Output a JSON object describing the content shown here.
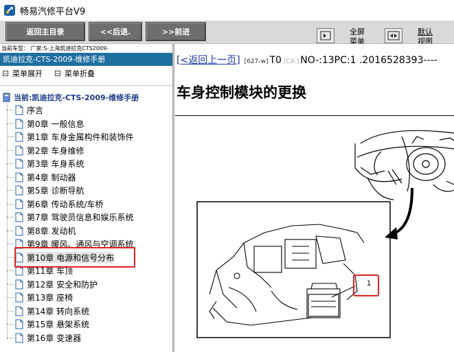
{
  "app": {
    "title": "畅易汽修平台V9"
  },
  "toolbar": {
    "back_main": "返回主目录",
    "back": "<<后退.",
    "forward": ">>前进",
    "fullscreen_line1": "全屏",
    "fullscreen_line2": "菜单",
    "default_line1": "默认",
    "default_line2": "视图"
  },
  "model_bar": "当前车型：  厂家:S-上海凯迪拉克CTS2009-",
  "sidebar": {
    "header": "凯迪拉克-CTS-2009-维修手册",
    "expand_label": "菜单展开",
    "collapse_label": "菜单折叠",
    "root": "当前:凯迪拉克-CTS-2009-维修手册",
    "items": [
      {
        "label": "序言"
      },
      {
        "label": "第0章 一般信息"
      },
      {
        "label": "第1章 车身金属构件和装饰件"
      },
      {
        "label": "第2章 车身维修"
      },
      {
        "label": "第3章 车身系统"
      },
      {
        "label": "第4章 制动器"
      },
      {
        "label": "第5章 诊断导航"
      },
      {
        "label": "第6章 传动系统/车桥"
      },
      {
        "label": "第7章 驾驶员信息和娱乐系统"
      },
      {
        "label": "第8章 发动机"
      },
      {
        "label": "第9章 暖风、通风与空调系统"
      },
      {
        "label": "第10章 电源和信号分布"
      },
      {
        "label": "第11章 车顶"
      },
      {
        "label": "第12章 安全和防护"
      },
      {
        "label": "第13章 座椅"
      },
      {
        "label": "第14章 转向系统"
      },
      {
        "label": "第15章 悬架系统"
      },
      {
        "label": "第16章 变速器"
      }
    ],
    "selected_index": 11
  },
  "content": {
    "back_link": "[<返回上一页]",
    "code1": "[627-w]",
    "t0": "T0",
    "code2": "[CX-]",
    "doc_no": "NO-:13PC:1 .2016528393----",
    "title": "车身控制模块的更换",
    "callout": "1"
  },
  "colors": {
    "sidebar_header_bg": "#1f6ea0",
    "nav_button_bg": "#6e6e6e",
    "toolbar_bg": "#d9d9d9",
    "link": "#1a3aa8",
    "highlight": "#e02020"
  },
  "icons": {
    "app": "wrench-logo-icon",
    "fullscreen": "fullscreen-icon",
    "default_view": "default-view-icon",
    "tree_root": "book-icon",
    "tree_item": "document-icon"
  }
}
